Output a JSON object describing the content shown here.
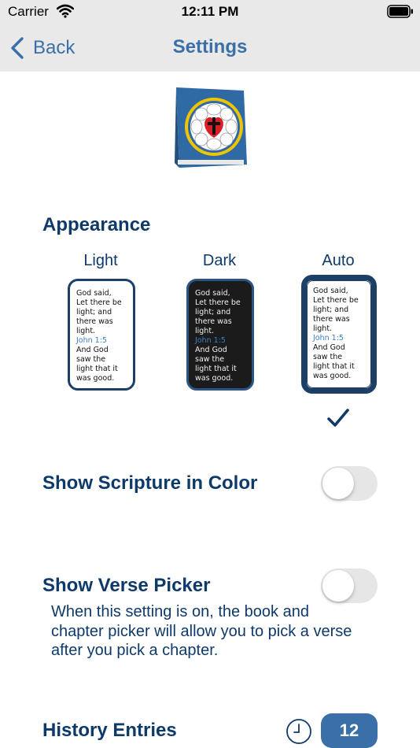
{
  "status_bar": {
    "carrier": "Carrier",
    "time": "12:11 PM"
  },
  "nav": {
    "back_label": "Back",
    "title": "Settings"
  },
  "appearance": {
    "heading": "Appearance",
    "options": [
      {
        "label": "Light",
        "theme": "light",
        "selected": false
      },
      {
        "label": "Dark",
        "theme": "dark",
        "selected": false
      },
      {
        "label": "Auto",
        "theme": "auto",
        "selected": true
      }
    ],
    "preview": {
      "line1": "God said,",
      "line2": "Let there be",
      "line3": "light; and",
      "line4": "there was",
      "line5": "light.",
      "ref": "John 1:5",
      "line6": "And God",
      "line7": "saw the",
      "line8": "light that it",
      "line9": "was good."
    }
  },
  "scripture_color": {
    "label": "Show Scripture in Color",
    "enabled": false
  },
  "verse_picker": {
    "label": "Show Verse Picker",
    "enabled": false,
    "description": "When this setting is on, the book and chapter picker will allow you to pick a verse after you pick a chapter."
  },
  "history": {
    "label": "History Entries",
    "value": "12"
  },
  "colors": {
    "navy": "#0e3a6a",
    "accent": "#3a6fa8",
    "nav_bg": "#e9e9e9"
  }
}
